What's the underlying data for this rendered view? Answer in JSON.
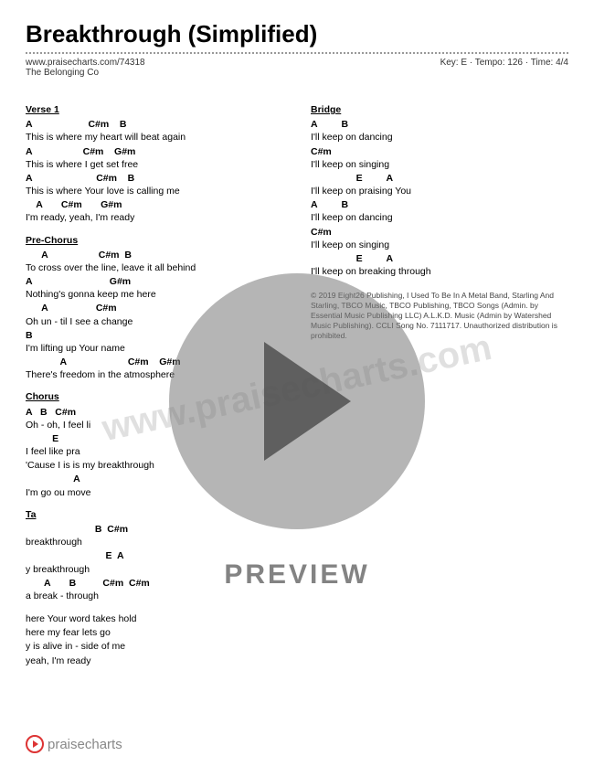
{
  "title": "Breakthrough (Simplified)",
  "url": "www.praisecharts.com/74318",
  "artist": "The Belonging Co",
  "meta_right": "Key: E · Tempo: 126 · Time: 4/4",
  "watermark": "www.praisecharts.com",
  "preview": "PREVIEW",
  "footer_brand": "praisecharts",
  "sections": {
    "verse1": {
      "label": "Verse 1",
      "lines": [
        {
          "chords": "A                     C#m    B",
          "lyric": "This is where my heart will beat again"
        },
        {
          "chords": "A                   C#m    G#m",
          "lyric": "This is where I  get  set free"
        },
        {
          "chords": "A                        C#m    B",
          "lyric": "This is where Your love is calling me"
        },
        {
          "chords": "    A       C#m       G#m",
          "lyric": "I'm ready, yeah, I'm ready"
        }
      ]
    },
    "prechorus": {
      "label": "Pre-Chorus",
      "lines": [
        {
          "chords": "      A                   C#m  B",
          "lyric": "To cross over the  line,  leave it all behind"
        },
        {
          "chords": "A                             G#m",
          "lyric": "Nothing's gonna keep me here"
        },
        {
          "chords": "      A                  C#m",
          "lyric": "Oh un - til I see a change"
        },
        {
          "chords": "B",
          "lyric": "I'm lifting up Your name"
        },
        {
          "chords": "             A                       C#m    G#m",
          "lyric": "There's freedom in the atmosphere"
        }
      ]
    },
    "chorus": {
      "label": "Chorus",
      "lines": [
        {
          "chords": "A   B   C#m",
          "lyric": "Oh  -  oh, I feel li"
        },
        {
          "chords": "          E",
          "lyric": "I feel like pra"
        },
        {
          "chords": "",
          "lyric": "'Cause I                 is is my breakthrough"
        },
        {
          "chords": "                  A",
          "lyric": "I'm go              ou move"
        }
      ]
    },
    "tag": {
      "label": "Ta",
      "lines": [
        {
          "chords": "                          B  C#m",
          "lyric": "                breakthrough"
        },
        {
          "chords": "                              E  A",
          "lyric": "            y breakthrough"
        },
        {
          "chords": "       A       B          C#m  C#m",
          "lyric": "        a break - through"
        }
      ]
    },
    "verse2_partial": {
      "lines": [
        {
          "lyric": "           here Your word takes hold"
        },
        {
          "lyric": "           here my fear lets go"
        },
        {
          "lyric": "              y is alive in - side of me"
        },
        {
          "lyric": "            yeah, I'm ready"
        }
      ]
    },
    "bridge": {
      "label": "Bridge",
      "lines": [
        {
          "chords": "A         B",
          "lyric": "I'll keep on dancing"
        },
        {
          "chords": "C#m",
          "lyric": "       I'll keep on singing"
        },
        {
          "chords": "                 E         A",
          "lyric": "I'll keep on praising You"
        },
        {
          "chords": "A         B",
          "lyric": "I'll keep on dancing"
        },
        {
          "chords": "C#m",
          "lyric": "       I'll keep on singing"
        },
        {
          "chords": "                 E         A",
          "lyric": "I'll keep on breaking through"
        }
      ]
    }
  },
  "copyright": "© 2019 Eight26 Publishing, I Used To Be In A Metal Band, Starling And Starling, TBCO Music, TBCO Publishing, TBCO Songs (Admin. by Essential Music Publishing LLC) A.L.K.D. Music (Admin by Watershed Music Publishing). CCLI Song No. 7111717. Unauthorized distribution is prohibited."
}
